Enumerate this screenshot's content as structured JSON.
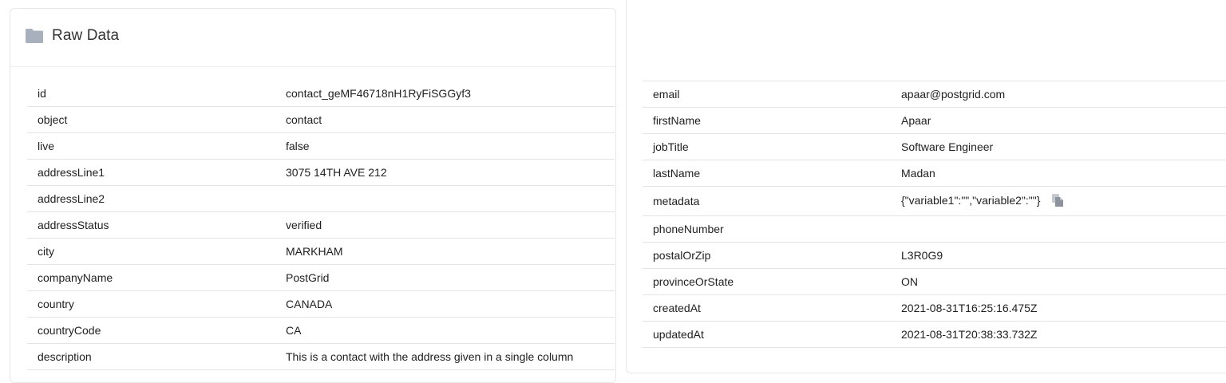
{
  "header": {
    "title": "Raw Data",
    "icon": "folder-icon"
  },
  "left_rows": [
    {
      "key": "id",
      "value": "contact_geMF46718nH1RyFiSGGyf3"
    },
    {
      "key": "object",
      "value": "contact"
    },
    {
      "key": "live",
      "value": "false"
    },
    {
      "key": "addressLine1",
      "value": "3075 14TH AVE 212"
    },
    {
      "key": "addressLine2",
      "value": ""
    },
    {
      "key": "addressStatus",
      "value": "verified"
    },
    {
      "key": "city",
      "value": "MARKHAM"
    },
    {
      "key": "companyName",
      "value": "PostGrid"
    },
    {
      "key": "country",
      "value": "CANADA"
    },
    {
      "key": "countryCode",
      "value": "CA"
    },
    {
      "key": "description",
      "value": "This is a contact with the address given in a single column"
    }
  ],
  "right_rows": [
    {
      "key": "email",
      "value": "apaar@postgrid.com"
    },
    {
      "key": "firstName",
      "value": "Apaar"
    },
    {
      "key": "jobTitle",
      "value": "Software Engineer"
    },
    {
      "key": "lastName",
      "value": "Madan"
    },
    {
      "key": "metadata",
      "value": "{\"variable1\":\"\",\"variable2\":\"\"}",
      "copy_icon": "copy-icon"
    },
    {
      "key": "phoneNumber",
      "value": ""
    },
    {
      "key": "postalOrZip",
      "value": "L3R0G9"
    },
    {
      "key": "provinceOrState",
      "value": "ON"
    },
    {
      "key": "createdAt",
      "value": "2021-08-31T16:25:16.475Z"
    },
    {
      "key": "updatedAt",
      "value": "2021-08-31T20:38:33.732Z"
    }
  ],
  "colors": {
    "icon": "#a9b0bd",
    "border": "#e3e3e3",
    "text": "#212121"
  }
}
